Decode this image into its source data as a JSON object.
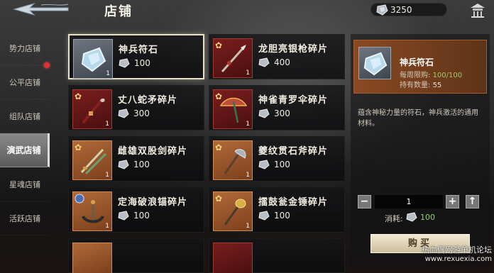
{
  "header": {
    "title": "店铺",
    "currency_amount": "3250",
    "back_icon": "arrow-back-icon",
    "home_icon": "pavilion-icon"
  },
  "sidebar": {
    "items": [
      {
        "label": "势力店铺"
      },
      {
        "label": "公平店铺"
      },
      {
        "label": "组队店铺"
      },
      {
        "label": "演武店铺"
      },
      {
        "label": "星魂店铺"
      },
      {
        "label": "活跃店铺"
      }
    ],
    "active_index": 3
  },
  "items": [
    {
      "name": "神兵符石",
      "price": "100",
      "qty": "1",
      "icon": "stone-icon"
    },
    {
      "name": "龙胆亮银枪碎片",
      "price": "400",
      "qty": "1",
      "icon": "spear-icon"
    },
    {
      "name": "丈八蛇矛碎片",
      "price": "300",
      "qty": "1",
      "icon": "lance-icon"
    },
    {
      "name": "神雀青罗伞碎片",
      "price": "300",
      "qty": "1",
      "icon": "umbrella-icon"
    },
    {
      "name": "雌雄双股剑碎片",
      "price": "100",
      "qty": "1",
      "icon": "twin-swords-icon"
    },
    {
      "name": "夔纹贯石斧碎片",
      "price": "100",
      "qty": "1",
      "icon": "axe-icon"
    },
    {
      "name": "定海破浪锚碎片",
      "price": "100",
      "qty": "1",
      "icon": "anchor-icon"
    },
    {
      "name": "擂鼓瓮金锤碎片",
      "price": "100",
      "qty": "1",
      "icon": "hammer-icon"
    }
  ],
  "detail": {
    "name": "神兵符石",
    "daily_limit_label": "每周限购:",
    "daily_limit_value": "100/100",
    "owned_label": "持有数量:",
    "owned_value": "55",
    "description": "蕴含神秘力量的符石，神兵激活的通用材料。",
    "quantity": "1",
    "minus": "−",
    "plus": "+",
    "max": "↑",
    "cost_label": "消耗:",
    "cost_value": "100",
    "buy_label": "购买"
  },
  "watermark": {
    "line1": "热血偶网游单机论坛",
    "line2": "www.rexuexia.com"
  }
}
